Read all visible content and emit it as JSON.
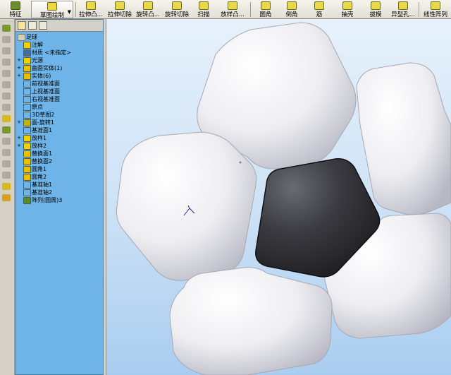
{
  "toolbar": {
    "buttons": [
      {
        "label": "特征",
        "icon": "features-icon"
      },
      {
        "label": "草图绘制",
        "icon": "sketch-icon"
      },
      {
        "label": "拉伸凸...",
        "icon": "extrude-boss-icon"
      },
      {
        "label": "拉伸切除",
        "icon": "extrude-cut-icon"
      },
      {
        "label": "旋转凸...",
        "icon": "revolve-boss-icon"
      },
      {
        "label": "旋转切除",
        "icon": "revolve-cut-icon"
      },
      {
        "label": "扫描",
        "icon": "sweep-icon"
      },
      {
        "label": "放样凸...",
        "icon": "loft-boss-icon"
      },
      {
        "label": "圆角",
        "icon": "fillet-icon"
      },
      {
        "label": "倒角",
        "icon": "chamfer-icon"
      },
      {
        "label": "筋",
        "icon": "rib-icon"
      },
      {
        "label": "抽壳",
        "icon": "shell-icon"
      },
      {
        "label": "拔模",
        "icon": "draft-icon"
      },
      {
        "label": "异型孔...",
        "icon": "hole-wizard-icon"
      },
      {
        "label": "线性阵列",
        "icon": "linear-pattern-icon"
      }
    ]
  },
  "tree": {
    "root": "足球",
    "items": [
      {
        "label": "注解",
        "icon": "annotations-icon",
        "expand": "",
        "color": "#f0d000"
      },
      {
        "label": "材质 <未指定>",
        "icon": "material-icon",
        "expand": "",
        "color": "#4a6aa0"
      },
      {
        "label": "光源",
        "icon": "lights-icon",
        "expand": "+",
        "color": "#f0d000"
      },
      {
        "label": "曲面实体(1)",
        "icon": "surface-bodies-icon",
        "expand": "+",
        "color": "#e8c000"
      },
      {
        "label": "实体(6)",
        "icon": "solid-bodies-icon",
        "expand": "+",
        "color": "#e8c000"
      },
      {
        "label": "前视基准面",
        "icon": "plane-icon",
        "expand": "",
        "color": "#6eb4e8"
      },
      {
        "label": "上视基准面",
        "icon": "plane-icon",
        "expand": "",
        "color": "#6eb4e8"
      },
      {
        "label": "右视基准面",
        "icon": "plane-icon",
        "expand": "",
        "color": "#6eb4e8"
      },
      {
        "label": "原点",
        "icon": "origin-icon",
        "expand": "",
        "color": "#6eb4e8"
      },
      {
        "label": "3D草图2",
        "icon": "sketch3d-icon",
        "expand": "",
        "color": "#6eb4e8"
      },
      {
        "label": "面-旋转1",
        "icon": "revolve-surface-icon",
        "expand": "+",
        "color": "#c8b000"
      },
      {
        "label": "基准面1",
        "icon": "plane-icon",
        "expand": "",
        "color": "#6eb4e8"
      },
      {
        "label": "放样1",
        "icon": "loft-icon",
        "expand": "+",
        "color": "#f0d000"
      },
      {
        "label": "放样2",
        "icon": "loft-icon",
        "expand": "+",
        "color": "#f0d000"
      },
      {
        "label": "替换面1",
        "icon": "replace-face-icon",
        "expand": "",
        "color": "#e8c000"
      },
      {
        "label": "替换面2",
        "icon": "replace-face-icon",
        "expand": "",
        "color": "#e8c000"
      },
      {
        "label": "圆角1",
        "icon": "fillet-feature-icon",
        "expand": "",
        "color": "#e8c000"
      },
      {
        "label": "圆角2",
        "icon": "fillet-feature-icon",
        "expand": "",
        "color": "#e8c000"
      },
      {
        "label": "基准轴1",
        "icon": "axis-icon",
        "expand": "",
        "color": "#6eb4e8"
      },
      {
        "label": "基准轴2",
        "icon": "axis-icon",
        "expand": "",
        "color": "#6eb4e8"
      },
      {
        "label": "阵列(圆周)3",
        "icon": "circular-pattern-icon",
        "expand": "",
        "color": "#5a8a2a"
      }
    ]
  },
  "colors": {
    "panel_bg": "#6eb4e8",
    "viewport_top": "#e6f1fb",
    "viewport_bottom": "#a9cdf0",
    "white_patch": "#f4f4f6",
    "black_patch": "#2c2c30"
  }
}
